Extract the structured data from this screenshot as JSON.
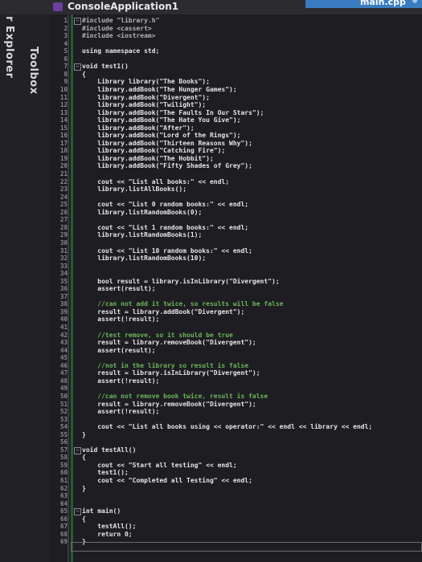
{
  "title": "ConsoleApplication1",
  "file_tab": {
    "label": "main.cpp",
    "pin": "⊕"
  },
  "side_tabs": {
    "explorer": "r Explorer",
    "toolbox": "Toolbox"
  },
  "lines": [
    {
      "n": "1",
      "t": "#include \"library.h\""
    },
    {
      "n": "2",
      "t": "#include <cassert>"
    },
    {
      "n": "3",
      "t": "#include <iostream>"
    },
    {
      "n": "4",
      "t": ""
    },
    {
      "n": "5",
      "t": "using namespace std;"
    },
    {
      "n": "6",
      "t": ""
    },
    {
      "n": "7",
      "t": "void test1()"
    },
    {
      "n": "8",
      "t": "{"
    },
    {
      "n": "9",
      "t": "    Library library(\"The Books\");"
    },
    {
      "n": "10",
      "t": "    library.addBook(\"The Hunger Games\");"
    },
    {
      "n": "11",
      "t": "    library.addBook(\"Divergent\");"
    },
    {
      "n": "12",
      "t": "    library.addBook(\"Twilight\");"
    },
    {
      "n": "13",
      "t": "    library.addBook(\"The Faults In Our Stars\");"
    },
    {
      "n": "14",
      "t": "    library.addBook(\"The Hate You Give\");"
    },
    {
      "n": "15",
      "t": "    library.addBook(\"After\");"
    },
    {
      "n": "16",
      "t": "    library.addBook(\"Lord of the Rings\");"
    },
    {
      "n": "17",
      "t": "    library.addBook(\"Thirteen Reasons Why\");"
    },
    {
      "n": "18",
      "t": "    library.addBook(\"Catching Fire\");"
    },
    {
      "n": "19",
      "t": "    library.addBook(\"The Hobbit\");"
    },
    {
      "n": "20",
      "t": "    library.addBook(\"Fifty Shades of Grey\");"
    },
    {
      "n": "21",
      "t": ""
    },
    {
      "n": "22",
      "t": "    cout << \"List all books:\" << endl;"
    },
    {
      "n": "23",
      "t": "    library.listAllBooks();"
    },
    {
      "n": "24",
      "t": ""
    },
    {
      "n": "25",
      "t": "    cout << \"List 0 random books:\" << endl;"
    },
    {
      "n": "26",
      "t": "    library.listRandomBooks(0);"
    },
    {
      "n": "27",
      "t": ""
    },
    {
      "n": "28",
      "t": "    cout << \"List 1 random books:\" << endl;"
    },
    {
      "n": "29",
      "t": "    library.listRandomBooks(1);"
    },
    {
      "n": "30",
      "t": ""
    },
    {
      "n": "31",
      "t": "    cout << \"List 10 random books:\" << endl;"
    },
    {
      "n": "32",
      "t": "    library.listRandomBooks(10);"
    },
    {
      "n": "33",
      "t": ""
    },
    {
      "n": "34",
      "t": ""
    },
    {
      "n": "35",
      "t": "    bool result = library.isInLibrary(\"Divergent\");"
    },
    {
      "n": "36",
      "t": "    assert(result);"
    },
    {
      "n": "37",
      "t": ""
    },
    {
      "n": "38",
      "t": "    //can not add it twice, so results will be false"
    },
    {
      "n": "39",
      "t": "    result = library.addBook(\"Divergent\");"
    },
    {
      "n": "40",
      "t": "    assert(!result);"
    },
    {
      "n": "41",
      "t": ""
    },
    {
      "n": "42",
      "t": "    //test remove, so it should be true"
    },
    {
      "n": "43",
      "t": "    result = library.removeBook(\"Divergent\");"
    },
    {
      "n": "44",
      "t": "    assert(result);"
    },
    {
      "n": "45",
      "t": ""
    },
    {
      "n": "46",
      "t": "    //not in the library so result is false"
    },
    {
      "n": "47",
      "t": "    result = library.isInLibrary(\"Divergent\");"
    },
    {
      "n": "48",
      "t": "    assert(!result);"
    },
    {
      "n": "49",
      "t": ""
    },
    {
      "n": "50",
      "t": "    //can not remove book twice, result is false"
    },
    {
      "n": "51",
      "t": "    result = library.removeBook(\"Divergent\");"
    },
    {
      "n": "52",
      "t": "    assert(!result);"
    },
    {
      "n": "53",
      "t": ""
    },
    {
      "n": "54",
      "t": "    cout << \"List all books using << operator:\" << endl << library << endl;"
    },
    {
      "n": "55",
      "t": "}"
    },
    {
      "n": "56",
      "t": ""
    },
    {
      "n": "57",
      "t": "void testAll()"
    },
    {
      "n": "58",
      "t": "{"
    },
    {
      "n": "59",
      "t": "    cout << \"Start all testing\" << endl;"
    },
    {
      "n": "60",
      "t": "    test1();"
    },
    {
      "n": "61",
      "t": "    cout << \"Completed all Testing\" << endl;"
    },
    {
      "n": "62",
      "t": "}"
    },
    {
      "n": "63",
      "t": ""
    },
    {
      "n": "64",
      "t": ""
    },
    {
      "n": "65",
      "t": "int main()"
    },
    {
      "n": "66",
      "t": "{"
    },
    {
      "n": "67",
      "t": "    testAll();"
    },
    {
      "n": "68",
      "t": "    return 0;"
    },
    {
      "n": "69",
      "t": "}"
    }
  ]
}
